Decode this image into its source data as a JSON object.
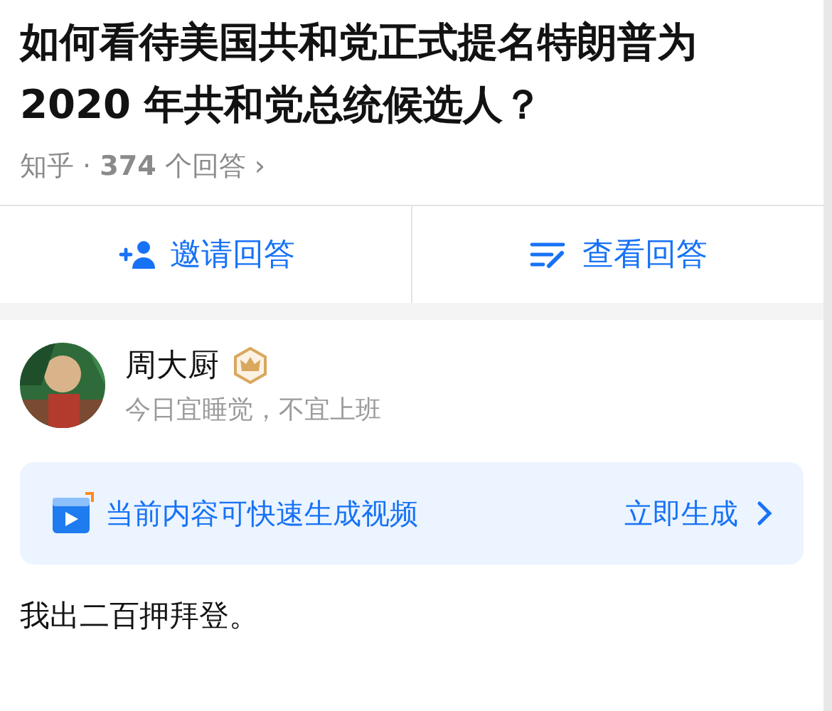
{
  "question": {
    "title": "如何看待美国共和党正式提名特朗普为 2020 年共和党总统候选人？",
    "meta": "知乎 · **374** 个回答",
    "chevron": "›"
  },
  "actions": [
    {
      "kind": "invite",
      "label": "邀请回答"
    },
    {
      "kind": "view",
      "label": "查看回答"
    }
  ],
  "answer": {
    "author": "周大厨",
    "badge": true,
    "bio": "今日宜睡觉，不宜上班",
    "banner": {
      "text": "当前内容可快速生成视频",
      "action": "立即生成"
    },
    "body": "我出二百押拜登。"
  }
}
